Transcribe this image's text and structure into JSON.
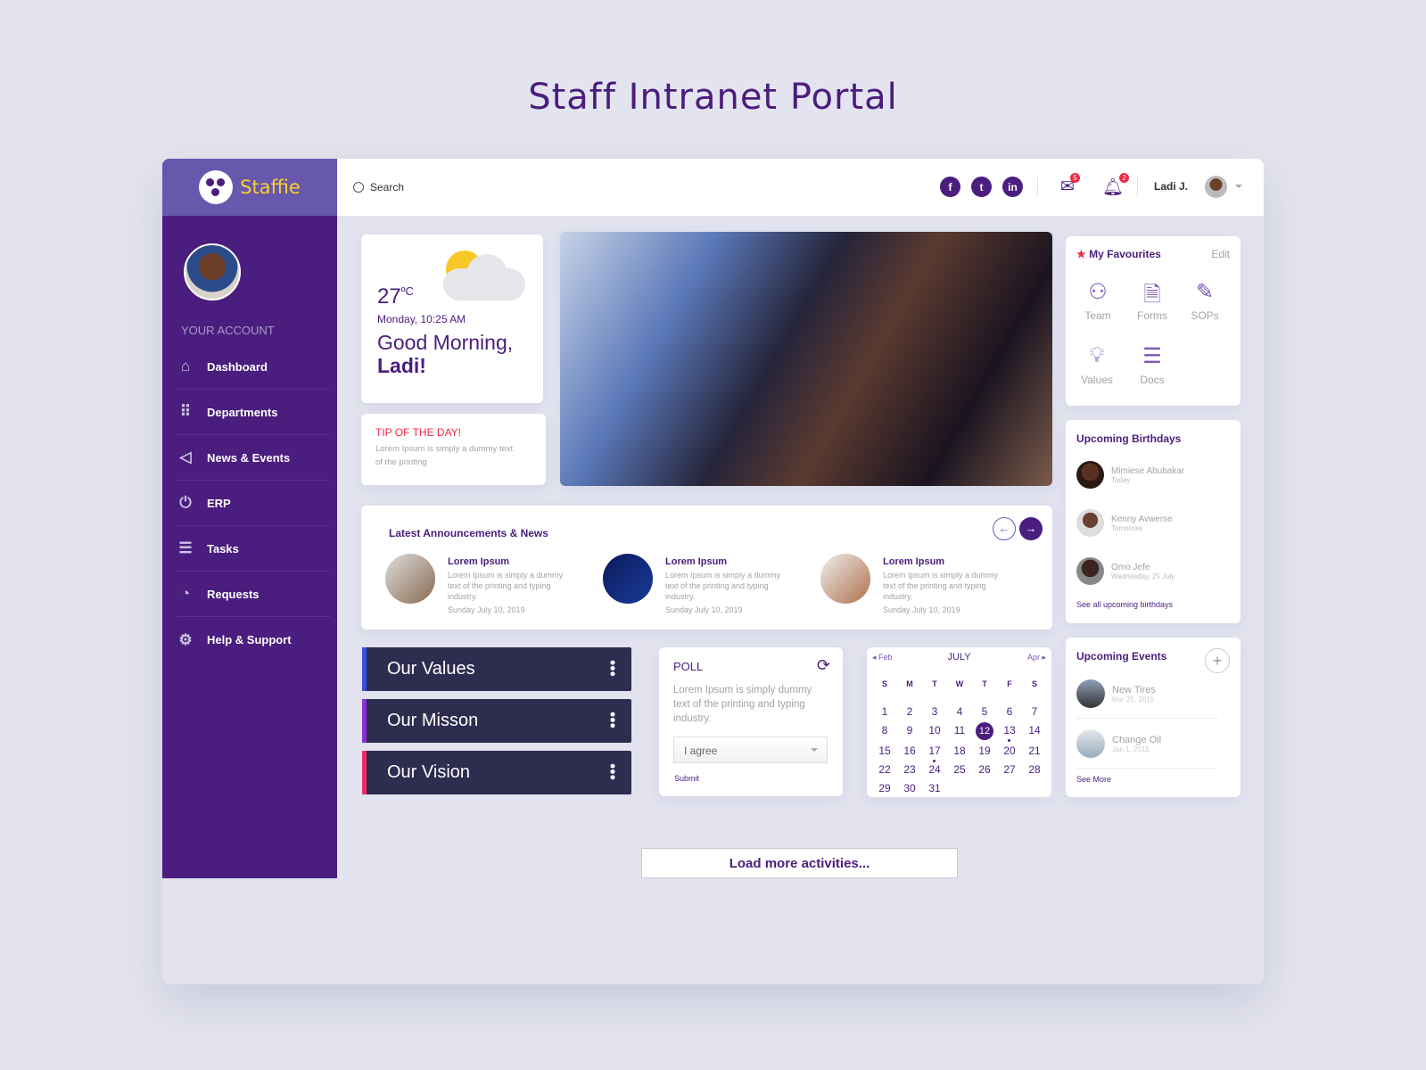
{
  "page_title": "Staff Intranet Portal",
  "brand": {
    "name": "Staffie",
    "accent": "#4a1d7e",
    "logo_text": "#f8d12f"
  },
  "sidebar": {
    "section": "YOUR ACCOUNT",
    "items": [
      {
        "label": "Dashboard",
        "icon": "home-icon"
      },
      {
        "label": "Departments",
        "icon": "grid-icon"
      },
      {
        "label": "News & Events",
        "icon": "megaphone-icon"
      },
      {
        "label": "ERP",
        "icon": "power-icon"
      },
      {
        "label": "Tasks",
        "icon": "list-icon"
      },
      {
        "label": "Requests",
        "icon": "pie-icon"
      },
      {
        "label": "Help & Support",
        "icon": "gear-icon"
      }
    ]
  },
  "header": {
    "search_placeholder": "Search",
    "social": [
      "f",
      "t",
      "in"
    ],
    "mail_count": "5",
    "notif_count": "2",
    "user": "Ladi J."
  },
  "weather": {
    "temp": "27",
    "unit": "ºC",
    "datetime": "Monday, 10:25 AM",
    "greeting": "Good Morning,",
    "name": "Ladi!"
  },
  "tip": {
    "title": "TIP OF THE DAY!",
    "text": "Lorem Ipsum is simply a dummy text of the printing"
  },
  "favourites": {
    "title": "My Favourites",
    "edit": "Edit",
    "items": [
      "Team",
      "Forms",
      "SOPs",
      "Values",
      "Docs"
    ]
  },
  "birthdays": {
    "title": "Upcoming Birthdays",
    "items": [
      {
        "name": "Mimiese Abubakar",
        "when": "Today"
      },
      {
        "name": "Kenny Avwerse",
        "when": "Tomorrow"
      },
      {
        "name": "Omo Jefe",
        "when": "Wednesday, 25 July"
      }
    ],
    "link": "See all upcoming birthdays"
  },
  "announcements": {
    "title": "Latest Announcements & News",
    "items": [
      {
        "title": "Lorem Ipsum",
        "text": "Lorem Ipsum is simply a dummy text of the printing and typing industry.",
        "date": "Sunday July 10, 2019"
      },
      {
        "title": "Lorem Ipsum",
        "text": "Lorem Ipsum is simply a dummy text of the printing and typing industry.",
        "date": "Sunday July 10, 2019"
      },
      {
        "title": "Lorem Ipsum",
        "text": "Lorem Ipsum is simply a dummy text of the printing and typing industry.",
        "date": "Sunday July 10, 2019"
      }
    ]
  },
  "values": [
    {
      "label": "Our Values",
      "color": "#3b4fe0"
    },
    {
      "label": "Our Misson",
      "color": "#8a2fd6"
    },
    {
      "label": "Our Vision",
      "color": "#ee2a6a"
    }
  ],
  "poll": {
    "title": "POLL",
    "question": "Lorem Ipsum is simply dummy text of the printing and typing industry.",
    "selected": "I agree",
    "submit": "Submit"
  },
  "calendar": {
    "month": "JULY",
    "prev": "Feb",
    "next": "Apr",
    "weekdays": [
      "S",
      "M",
      "T",
      "W",
      "T",
      "F",
      "S"
    ],
    "days": 31,
    "selected": 12,
    "marked": [
      13,
      17
    ]
  },
  "events": {
    "title": "Upcoming Events",
    "items": [
      {
        "name": "New Tires",
        "date": "Mar 25, 2015"
      },
      {
        "name": "Change Oil",
        "date": "Jan 1, 2015"
      }
    ],
    "link": "See More"
  },
  "load_more": "Load more activities..."
}
